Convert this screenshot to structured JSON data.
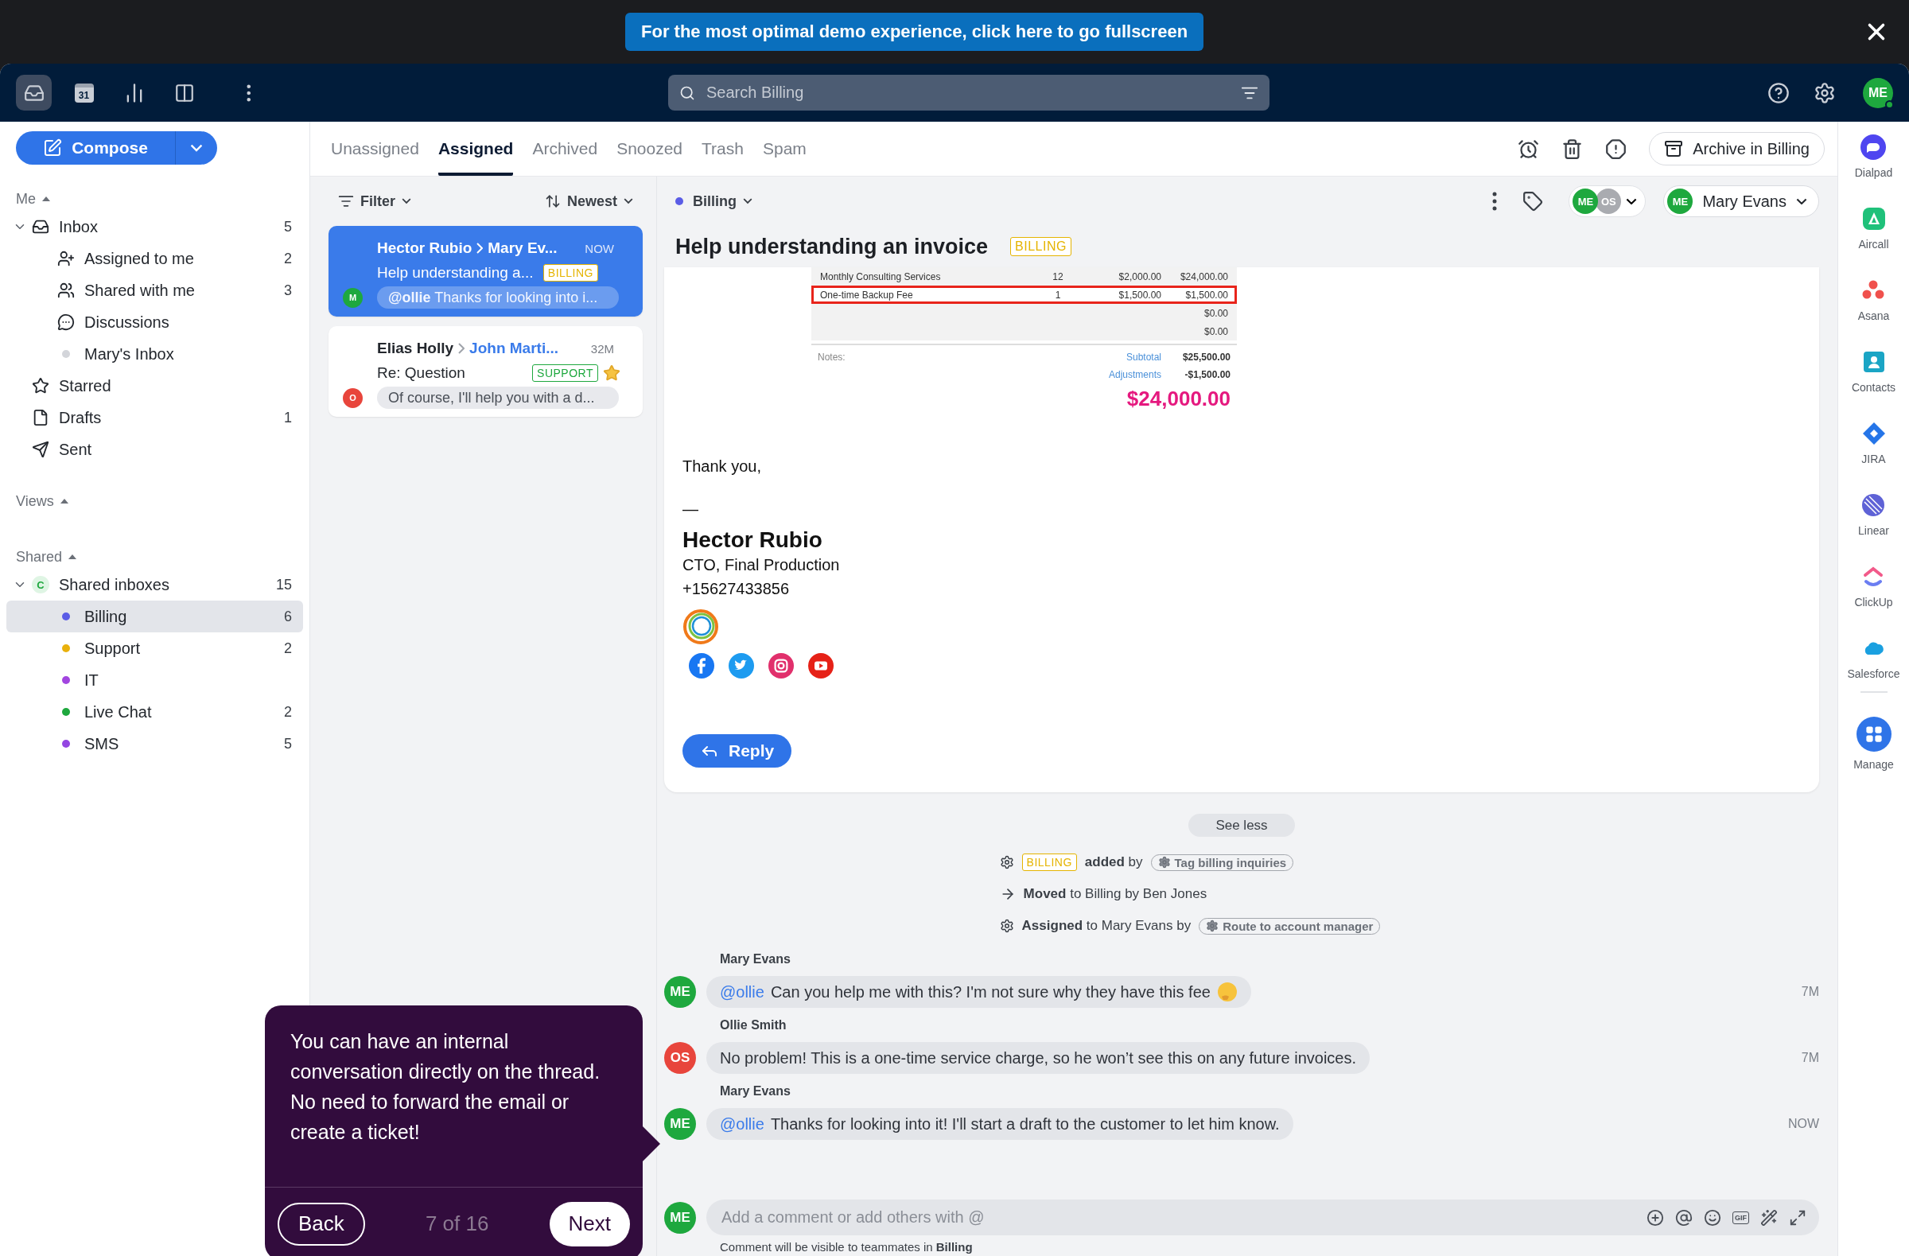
{
  "banner": {
    "text": "For the most optimal demo experience, click here to go fullscreen"
  },
  "nav": {
    "apps": [
      {
        "kind": "inbox",
        "selected": true
      },
      {
        "kind": "calendar",
        "label": "31",
        "selected": false
      },
      {
        "kind": "chart",
        "selected": false
      },
      {
        "kind": "columns",
        "selected": false
      },
      {
        "kind": "more",
        "selected": false
      }
    ],
    "search": {
      "placeholder": "Search Billing"
    },
    "user": {
      "initials": "ME",
      "online": true
    }
  },
  "sidebar": {
    "compose": "Compose",
    "sections": [
      {
        "title": "Me",
        "expanded": true,
        "items": [
          {
            "kind": "inbox",
            "label": "Inbox",
            "count": "5",
            "expanded": true,
            "selected": false,
            "children": [
              {
                "kind": "assign",
                "label": "Assigned to me",
                "count": "2",
                "selected": false
              },
              {
                "kind": "people",
                "label": "Shared with me",
                "count": "3",
                "selected": false
              },
              {
                "kind": "chat",
                "label": "Discussions",
                "selected": false
              },
              {
                "kind": "dot",
                "label": "Mary's Inbox",
                "color": "#d3d5da",
                "selected": false
              }
            ]
          },
          {
            "kind": "star",
            "label": "Starred",
            "selected": false
          },
          {
            "kind": "draft",
            "label": "Drafts",
            "count": "1",
            "selected": false
          },
          {
            "kind": "send",
            "label": "Sent",
            "selected": false
          }
        ]
      },
      {
        "title": "Views",
        "expanded": true
      },
      {
        "title": "Shared",
        "expanded": true,
        "items": [
          {
            "kind": "badge",
            "badge": "C",
            "label": "Shared inboxes",
            "count": "15",
            "expanded": true,
            "selected": false,
            "children": [
              {
                "kind": "dot",
                "label": "Billing",
                "count": "6",
                "color": "#5a5ce6",
                "selected": true
              },
              {
                "kind": "dot",
                "label": "Support",
                "count": "2",
                "color": "#e9b10c",
                "selected": false
              },
              {
                "kind": "dot",
                "label": "IT",
                "color": "#a245e0",
                "selected": false
              },
              {
                "kind": "dot",
                "label": "Live Chat",
                "count": "2",
                "color": "#1ea83e",
                "selected": false
              },
              {
                "kind": "dot",
                "label": "SMS",
                "count": "5",
                "color": "#9446e2",
                "selected": false
              }
            ]
          }
        ]
      }
    ]
  },
  "tabs": [
    {
      "label": "Unassigned",
      "selected": false
    },
    {
      "label": "Assigned",
      "selected": true
    },
    {
      "label": "Archived",
      "selected": false
    },
    {
      "label": "Snoozed",
      "selected": false
    },
    {
      "label": "Trash",
      "selected": false
    },
    {
      "label": "Spam",
      "selected": false
    }
  ],
  "toolbar": {
    "archive_button": "Archive in Billing"
  },
  "list": {
    "filter": "Filter",
    "sort": "Newest",
    "conversations": [
      {
        "from": "Hector Rubio",
        "to": "Mary Ev...",
        "time": "NOW",
        "subject": "Help understanding a...",
        "tag": {
          "label": "BILLING",
          "color": "#e5b400"
        },
        "avatar": {
          "initials": "M",
          "color": "#1ea83e"
        },
        "preview": "**@ollie** Thanks for looking into i...",
        "selected": true,
        "starred": false
      },
      {
        "from": "Elias Holly",
        "to": "John Marti...",
        "time": "32M",
        "subject": "Re: Question",
        "tag": {
          "label": "SUPPORT",
          "color": "#1ea83e"
        },
        "avatar": {
          "initials": "O",
          "color": "#e8453c"
        },
        "preview": "Of course, I'll help you with a d...",
        "selected": false,
        "starred": true
      }
    ]
  },
  "conversation": {
    "inbox": {
      "label": "Billing",
      "color": "#5a5ce6"
    },
    "followers": [
      {
        "initials": "ME",
        "color": "#1ea83e"
      },
      {
        "initials": "OS",
        "color": "#a9abb0"
      }
    ],
    "assignee": {
      "initials": "ME",
      "name": "Mary Evans"
    },
    "title": "Help understanding an invoice",
    "tag": {
      "label": "BILLING"
    },
    "invoice": {
      "rows": [
        {
          "description": "Monthly Consulting Services",
          "qty": "12",
          "rate": "$2,000.00",
          "amount": "$24,000.00",
          "highlighted": false
        },
        {
          "description": "One-time Backup Fee",
          "qty": "1",
          "rate": "$1,500.00",
          "amount": "$1,500.00",
          "highlighted": true
        },
        {
          "amount": "$0.00",
          "highlighted": false
        },
        {
          "amount": "$0.00",
          "highlighted": false
        }
      ],
      "notes": "Notes:",
      "totals": [
        {
          "label": "Subtotal",
          "value": "$25,500.00"
        },
        {
          "label": "Adjustments",
          "value": "-$1,500.00"
        }
      ],
      "total": "$24,000.00"
    },
    "body": [
      "Thank you,",
      "—"
    ],
    "signature": {
      "name": "Hector Rubio",
      "lines": [
        "CTO, Final Production",
        "+15627433856"
      ],
      "social": [
        {
          "kind": "round",
          "color": "#1877f2"
        },
        {
          "kind": "bird",
          "color": "#1d9bf0"
        },
        {
          "kind": "camera",
          "color": "#e1306c"
        },
        {
          "kind": "play",
          "color": "#e62117"
        }
      ]
    },
    "reply": "Reply",
    "see_less": "See less",
    "activity": [
      {
        "kind": "rule",
        "tag": "BILLING",
        "text": "**added** by",
        "chip": "Tag billing inquiries"
      },
      {
        "kind": "move",
        "text": "**Moved** to Billing by Ben Jones"
      },
      {
        "kind": "rule",
        "text": "**Assigned** to Mary Evans by",
        "chip": "Route to account manager"
      }
    ],
    "comments": [
      {
        "author": "Mary Evans",
        "initials": "ME",
        "color": "#1ea83e",
        "mention": "@ollie",
        "text": "Can you help me with this? I'm not sure why they have this fee",
        "emoji": true,
        "time": "7M"
      },
      {
        "author": "Ollie Smith",
        "initials": "OS",
        "color": "#e8453c",
        "text": "No problem! This is a one-time service charge, so he won’t see this on any future invoices.",
        "emoji": false,
        "time": "7M"
      },
      {
        "author": "Mary Evans",
        "initials": "ME",
        "color": "#1ea83e",
        "mention": "@ollie",
        "text": "Thanks for looking into it! I'll start a draft to the customer to let him know.",
        "emoji": false,
        "time": "NOW"
      }
    ],
    "composer": {
      "initials": "ME",
      "placeholder": "Add a comment or add others with @",
      "gif": "GIF",
      "note": "Comment will be visible to teammates in **Billing**"
    }
  },
  "apps": [
    {
      "kind": "bubble",
      "label": "Dialpad"
    },
    {
      "kind": "triangle",
      "label": "Aircall"
    },
    {
      "kind": "dots",
      "label": "Asana"
    },
    {
      "kind": "person",
      "label": "Contacts"
    },
    {
      "kind": "diamond",
      "label": "JIRA"
    },
    {
      "kind": "stripes",
      "label": "Linear"
    },
    {
      "kind": "chevron",
      "label": "ClickUp"
    },
    {
      "kind": "cloud",
      "label": "Salesforce"
    },
    {
      "kind": "grid",
      "label": "Manage"
    }
  ],
  "tour": {
    "text": "You can have an internal conversation directly on the thread. No need to forward the email or create a ticket!",
    "back": "Back",
    "step": "7 of 16",
    "next": "Next"
  }
}
